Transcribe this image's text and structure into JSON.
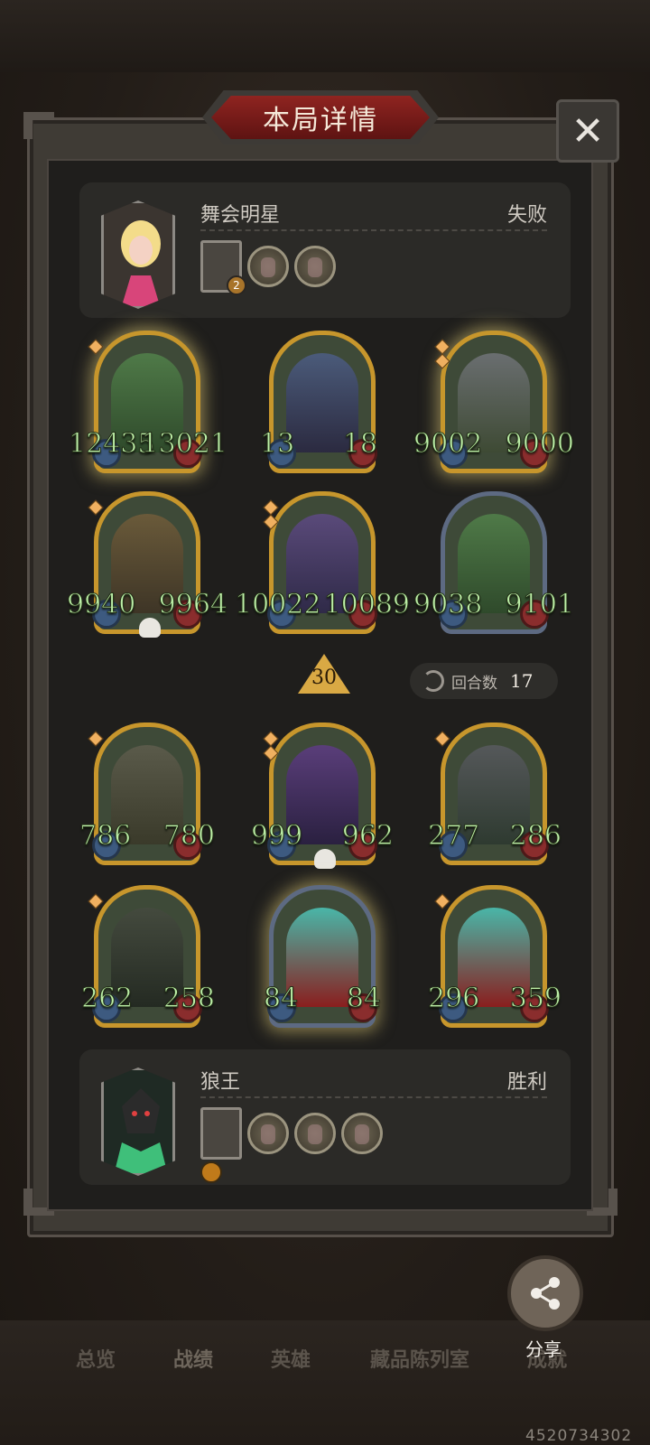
{
  "title": "本局详情",
  "close_icon": "close-icon",
  "opponent": {
    "name": "舞会明星",
    "result": "失败",
    "hero_level_badge": "2"
  },
  "player": {
    "name": "狼王",
    "result": "胜利"
  },
  "opponent_units": [
    {
      "atk": "12435",
      "hp": "13021"
    },
    {
      "atk": "13",
      "hp": "18"
    },
    {
      "atk": "9002",
      "hp": "9000"
    },
    {
      "atk": "9940",
      "hp": "9964"
    },
    {
      "atk": "10022",
      "hp": "10089"
    },
    {
      "atk": "9038",
      "hp": "9101"
    }
  ],
  "player_units": [
    {
      "atk": "786",
      "hp": "780"
    },
    {
      "atk": "999",
      "hp": "962"
    },
    {
      "atk": "277",
      "hp": "286"
    },
    {
      "atk": "262",
      "hp": "258"
    },
    {
      "atk": "84",
      "hp": "84"
    },
    {
      "atk": "296",
      "hp": "359"
    }
  ],
  "level": "30",
  "rounds": {
    "label": "回合数",
    "value": "17"
  },
  "share_label": "分享",
  "nav": {
    "overview": "总览",
    "records": "战绩",
    "heroes": "英雄",
    "collection": "藏品陈列室",
    "achievements": "成就"
  },
  "uid": "4520734302",
  "colors": {
    "accent_red": "#8f2420",
    "gold": "#c7962c",
    "stat_green": "#bdf0a8"
  }
}
